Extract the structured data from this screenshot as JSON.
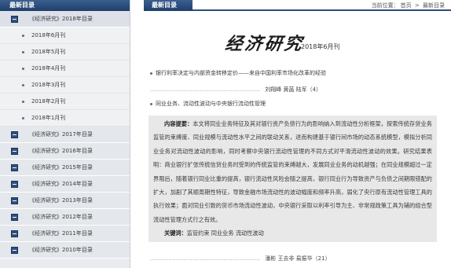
{
  "sidebar": {
    "title": "最新目录",
    "years": [
      {
        "label": "《经济研究》2018年目录",
        "open": true,
        "months": [
          "2018年6月刊",
          "2018年5月刊",
          "2018年4月刊",
          "2018年3月刊",
          "2018年2月刊",
          "2018年1月刊"
        ]
      },
      {
        "label": "《经济研究》2017年目录"
      },
      {
        "label": "《经济研究》2016年目录"
      },
      {
        "label": "《经济研究》2015年目录"
      },
      {
        "label": "《经济研究》2014年目录"
      },
      {
        "label": "《经济研究》2013年目录"
      },
      {
        "label": "《经济研究》2012年目录"
      },
      {
        "label": "《经济研究》2011年目录"
      },
      {
        "label": "《经济研究》2010年目录"
      }
    ]
  },
  "main": {
    "tab": "最新目录",
    "breadcrumb": {
      "prefix": "当前位置：",
      "home": "首页",
      "sep": " > ",
      "current": "最新目录"
    },
    "logo": "经济研究",
    "issue": "2018年6月刊",
    "articles": [
      {
        "title": "银行利率决定与内部资金转移定价——来自中国利率市场化改革的经验",
        "rule": "……………………………………………………",
        "authors": "刘翔峰 黄菡 陆军（4）"
      },
      {
        "title": "同业业务、流动性波动与中央银行流动性管理"
      }
    ],
    "abstract_label": "内容提要：",
    "abstract_text": "本文将同业业务特征及其对银行资产负债行为的影响纳入到流动性分析框架，探索传统存贷业务监管的束缚度、同业规模与流动性水平之间的联动关系，进而构建基于银行间市场的动态系统模型，模拟分析同业业务对流动性波动的影响，同时考察中央银行流动性管理的不同方式对平滑流动性波动的效果。研究结果表明：商业银行扩张传统信贷业务时受到的传统监管的束缚越大，发展同业业务的动机越强；在同业规模超过一定界限后，随着银行同业比重的提高，银行流动性风险会随之提高，银行同业行为导致资产与负债之间期限错配的扩大，加剧了其顺周期性特征，导致金融市场流动性的波动幅度和频率升高，弱化了央行原有流动性管理工具的执行效果；面对同业引致的货币市场流动性波动，中央银行采取以利率引导为主、非常规政策工具为辅的组合型流动性管理方式行之有效。",
    "keywords_label": "关键词：",
    "keywords_text": "监管约束 同业业务 流动性波动",
    "second_byline": {
      "rule": "……………………………………………………",
      "authors": "潘彬 王去非 易振华（21）"
    }
  }
}
